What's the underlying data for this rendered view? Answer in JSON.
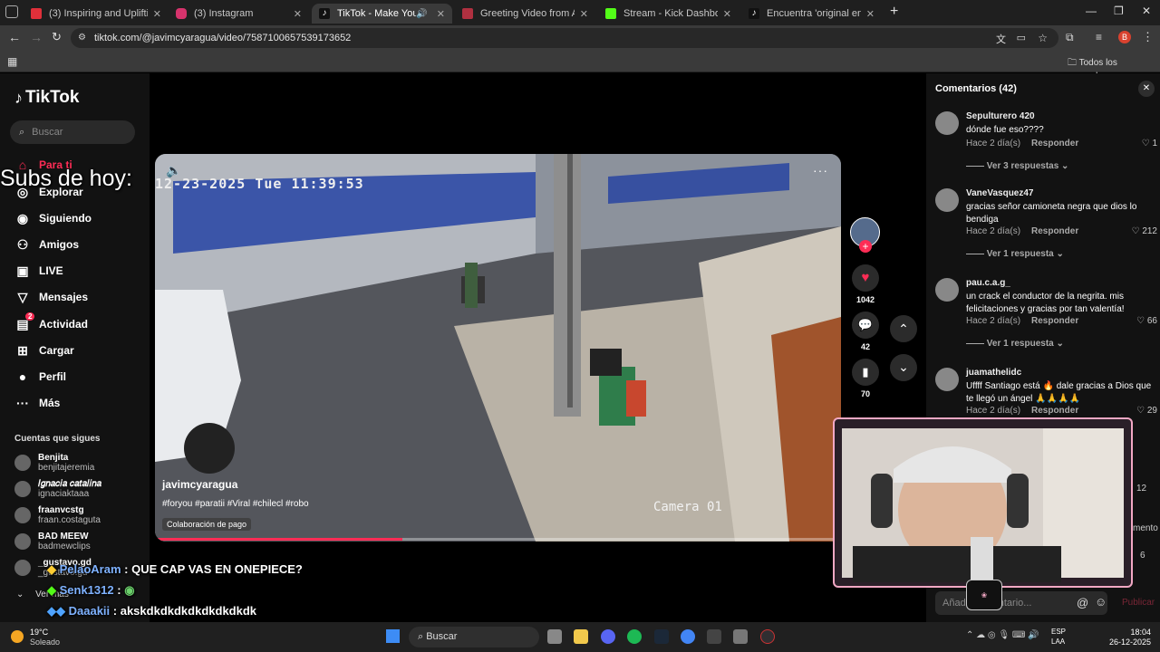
{
  "browser": {
    "tabs": [
      {
        "title": "(3) Inspiring and Uplifting Backg",
        "color": "#e0303a"
      },
      {
        "title": "(3) Instagram",
        "color": "#d6336c"
      },
      {
        "title": "TikTok - Make Your Day",
        "color": "#111111"
      },
      {
        "title": "Greeting Video from Africa – dai",
        "color": "#b03040"
      },
      {
        "title": "Stream - Kick Dashboard",
        "color": "#53fc18"
      },
      {
        "title": "Encuentra 'original en que asp",
        "color": "#111111"
      }
    ],
    "url": "tiktok.com/@javimcyaragua/video/7587100657539173652",
    "bookmarks_label": "Todos los marcadores",
    "new_tab": "+",
    "close": "✕"
  },
  "tiktok": {
    "logo": "TikTok",
    "search_placeholder": "Buscar",
    "nav": [
      {
        "label": "Para ti",
        "icon": "home-icon",
        "color": "#fe2c55"
      },
      {
        "label": "Explorar",
        "icon": "compass-icon",
        "color": "#ffffff"
      },
      {
        "label": "Siguiendo",
        "icon": "following-icon",
        "color": "#ffffff"
      },
      {
        "label": "Amigos",
        "icon": "friends-icon",
        "color": "#ffffff"
      },
      {
        "label": "LIVE",
        "icon": "live-icon",
        "color": "#ffffff"
      },
      {
        "label": "Mensajes",
        "icon": "messages-icon",
        "color": "#ffffff"
      },
      {
        "label": "Actividad",
        "icon": "activity-icon",
        "color": "#ffffff"
      },
      {
        "label": "Cargar",
        "icon": "upload-icon",
        "color": "#ffffff"
      },
      {
        "label": "Perfil",
        "icon": "profile-icon",
        "color": "#ffffff"
      },
      {
        "label": "Más",
        "icon": "more-icon",
        "color": "#ffffff"
      }
    ],
    "activity_badge": "2",
    "following_header": "Cuentas que sigues",
    "following": [
      {
        "name": "Benjita",
        "handle": "benjitajeremia"
      },
      {
        "name": "𝐼𝑔𝑛𝑎𝑐𝑖𝑎 𝑐𝑎𝑡𝑎𝑙𝑖𝑛𝑎",
        "handle": "ignaciaktaaa"
      },
      {
        "name": "fraanvcstg",
        "handle": "fraan.costaguta"
      },
      {
        "name": "BAD MEEW",
        "handle": "badmewclips"
      },
      {
        "name": "_gustavo.gd",
        "handle": "_gustavo.gd"
      }
    ],
    "see_more": "Ver más",
    "video": {
      "timestamp": "12-23-2025 Tue 11:39:53",
      "camera": "Camera 01",
      "author": "javimcyaragua",
      "hashtags": "#foryou #paratii #Viral #chilecl #robo",
      "collab": "Colaboración de pago",
      "progress": 0.36
    },
    "actions": {
      "likes": "1042",
      "comments": "42",
      "saves": "70"
    },
    "comments_header": "Comentarios (42)",
    "comments": [
      {
        "user": "Sepulturero 420",
        "text": "dónde fue eso????",
        "time": "Hace 2 día(s)",
        "reply": "Responder",
        "likes": "1",
        "more": "Ver 3 respuestas"
      },
      {
        "user": "VaneVasquez47",
        "text": "gracias señor camioneta negra que dios lo bendiga",
        "time": "Hace 2 día(s)",
        "reply": "Responder",
        "likes": "212",
        "more": "Ver 1 respuesta"
      },
      {
        "user": "pau.c.a.g_",
        "text": "un crack el conductor de la negrita. mis felicitaciones y gracias por tan valentía!",
        "time": "Hace 2 día(s)",
        "reply": "Responder",
        "likes": "66",
        "more": "Ver 1 respuesta"
      },
      {
        "user": "juamathelidc",
        "text": "Uffff Santiago está 🔥 dale gracias a Dios que te llegó un ángel 🙏🙏🙏🙏",
        "time": "Hace 2 día(s)",
        "reply": "Responder",
        "likes": "29",
        "more": ""
      }
    ],
    "partial_counts": [
      "12",
      "6"
    ],
    "partial_text": "mento",
    "comment_placeholder": "Añadir comentario...",
    "publish": "Publicar"
  },
  "overlay": {
    "subs_label": "Subs de hoy:",
    "chat": [
      {
        "user": "PelaoAram",
        "msg": ": QUE CAP VAS EN ONEPIECE?"
      },
      {
        "user": "Senk1312",
        "msg": ":"
      },
      {
        "user": "Daaakii",
        "msg": ": akskdkdkdkdkdkdkdkdk"
      }
    ]
  },
  "taskbar": {
    "weather_temp": "19°C",
    "weather_desc": "Soleado",
    "search": "Buscar",
    "lang": "ESP",
    "lang2": "LAA",
    "time": "18:04",
    "date": "26-12-2025"
  }
}
